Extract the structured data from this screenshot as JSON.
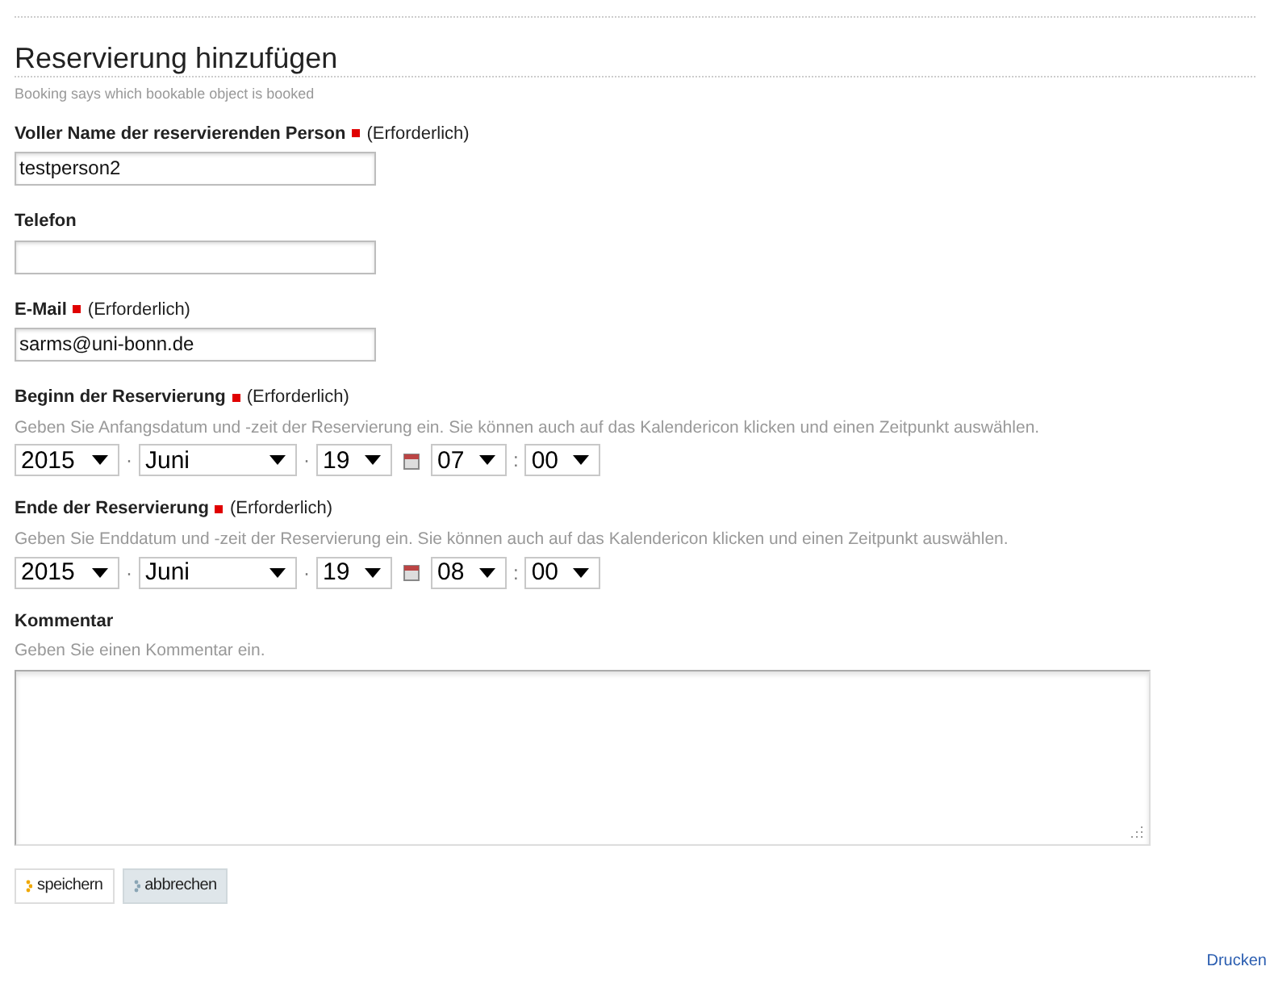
{
  "title": "Reservierung hinzufügen",
  "subtitle": "Booking says which bookable object is booked",
  "fields": [
    {
      "kind": "text",
      "label": "Voller Name der reservierenden Person",
      "required": true,
      "required_note": "(Erforderlich)",
      "value": "testperson2"
    },
    {
      "kind": "text",
      "label": "Telefon",
      "required": false
    },
    {
      "kind": "text",
      "label": "E-Mail",
      "required": true,
      "required_note": "(Erforderlich)",
      "value": "sarms@uni-bonn.de"
    },
    {
      "kind": "datetime",
      "label": "Beginn der Reservierung",
      "required": true,
      "required_note": "(Erforderlich)",
      "hint": "Geben Sie Anfangsdatum und -zeit der Reservierung ein. Sie können auch auf das Kalendericon klicken und einen Zeitpunkt auswählen.",
      "year": "2015",
      "month": "Juni",
      "day": "19",
      "hour": "07",
      "minute": "00",
      "date_separator": "·",
      "time_separator": ":"
    },
    {
      "kind": "datetime",
      "label": "Ende der Reservierung",
      "required": true,
      "required_note": "(Erforderlich)",
      "hint": "Geben Sie Enddatum und -zeit der Reservierung ein. Sie können auch auf das Kalendericon klicken und einen Zeitpunkt auswählen.",
      "year": "2015",
      "month": "Juni",
      "day": "19",
      "hour": "08",
      "minute": "00",
      "date_separator": "·",
      "time_separator": ":"
    },
    {
      "kind": "textarea",
      "label": "Kommentar",
      "required": false,
      "hint": "Geben Sie einen Kommentar ein."
    }
  ],
  "buttons": [
    {
      "label": "speichern",
      "kind": "primary"
    },
    {
      "label": "abbrechen",
      "kind": "secondary"
    }
  ],
  "print_link": "Drucken"
}
